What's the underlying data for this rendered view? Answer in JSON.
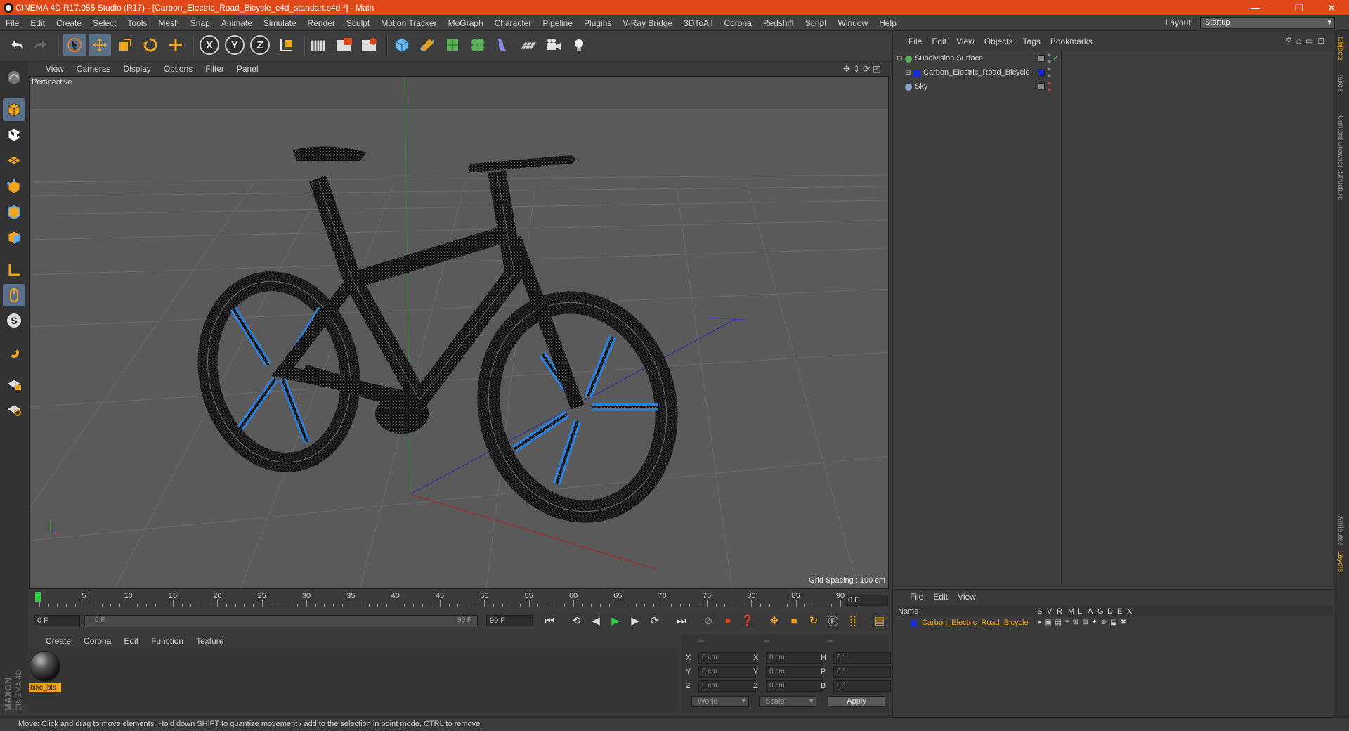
{
  "window": {
    "title": "CINEMA 4D R17.055 Studio (R17) - [Carbon_Electric_Road_Bicycle_c4d_standart.c4d *] - Main",
    "minimize": "—",
    "restore": "❐",
    "close": "✕"
  },
  "menu": [
    "File",
    "Edit",
    "Create",
    "Select",
    "Tools",
    "Mesh",
    "Snap",
    "Animate",
    "Simulate",
    "Render",
    "Sculpt",
    "Motion Tracker",
    "MoGraph",
    "Character",
    "Pipeline",
    "Plugins",
    "V-Ray Bridge",
    "3DToAll",
    "Corona",
    "Redshift",
    "Script",
    "Window",
    "Help"
  ],
  "layout": {
    "label": "Layout:",
    "value": "Startup"
  },
  "toolbar": {
    "undo": "undo-icon",
    "redo": "redo-icon",
    "select": "select-icon",
    "move": "move-icon",
    "scale": "scale-icon",
    "rotate": "rotate-icon",
    "last_tool": "last-tool-icon",
    "x": "X",
    "y": "Y",
    "z": "Z",
    "coord": "coordinate-system-icon"
  },
  "viewport": {
    "menu": [
      "View",
      "Cameras",
      "Display",
      "Options",
      "Filter",
      "Panel"
    ],
    "label": "Perspective",
    "grid_spacing": "Grid Spacing : 100 cm"
  },
  "timeline": {
    "ticks": [
      "0",
      "5",
      "10",
      "15",
      "20",
      "25",
      "30",
      "35",
      "40",
      "45",
      "50",
      "55",
      "60",
      "65",
      "70",
      "75",
      "80",
      "85",
      "90"
    ],
    "end_field": "0 F",
    "start": "0 F",
    "slider_start": "0 F",
    "slider_end": "90 F",
    "end": "90 F"
  },
  "material_manager": {
    "menu": [
      "Create",
      "Corona",
      "Edit",
      "Function",
      "Texture"
    ],
    "materials": [
      {
        "name": "bike_bla"
      }
    ]
  },
  "coordinates": {
    "headers": [
      "--",
      "--",
      "--"
    ],
    "rows": [
      {
        "a": "X",
        "av": "0 cm",
        "b": "X",
        "bv": "0 cm",
        "c": "H",
        "cv": "0 °"
      },
      {
        "a": "Y",
        "av": "0 cm",
        "b": "Y",
        "bv": "0 cm",
        "c": "P",
        "cv": "0 °"
      },
      {
        "a": "Z",
        "av": "0 cm",
        "b": "Z",
        "bv": "0 cm",
        "c": "B",
        "cv": "0 °"
      }
    ],
    "space": "World",
    "mode": "Scale",
    "apply": "Apply"
  },
  "object_manager": {
    "menu": [
      "File",
      "Edit",
      "View",
      "Objects",
      "Tags",
      "Bookmarks"
    ],
    "objects": [
      {
        "name": "Subdivision Surface",
        "color": "#5ab05a"
      },
      {
        "name": "Carbon_Electric_Road_Bicycle",
        "color": "#1a2ad8"
      },
      {
        "name": "Sky",
        "color": "#8aa6c8"
      }
    ]
  },
  "layer_manager": {
    "menu": [
      "File",
      "Edit",
      "View"
    ],
    "columns": [
      "Name",
      "S",
      "V",
      "R",
      "M",
      "L",
      "A",
      "G",
      "D",
      "E",
      "X"
    ],
    "layers": [
      {
        "name": "Carbon_Electric_Road_Bicycle",
        "color": "#1a2ad8"
      }
    ]
  },
  "side_tabs": [
    "Objects",
    "Takes",
    "Content Browser",
    "Structure",
    "Attributes",
    "Layers"
  ],
  "logo": {
    "line1": "MAXON",
    "line2": "CINEMA 4D"
  },
  "status": "Move: Click and drag to move elements. Hold down SHIFT to quantize movement / add to the selection in point mode, CTRL to remove.",
  "colors": {
    "accent": "#e0481a",
    "selected_tool": "#5a6f88",
    "material_label": "#f0a51a",
    "bike_blue": "#2f7fd8"
  }
}
